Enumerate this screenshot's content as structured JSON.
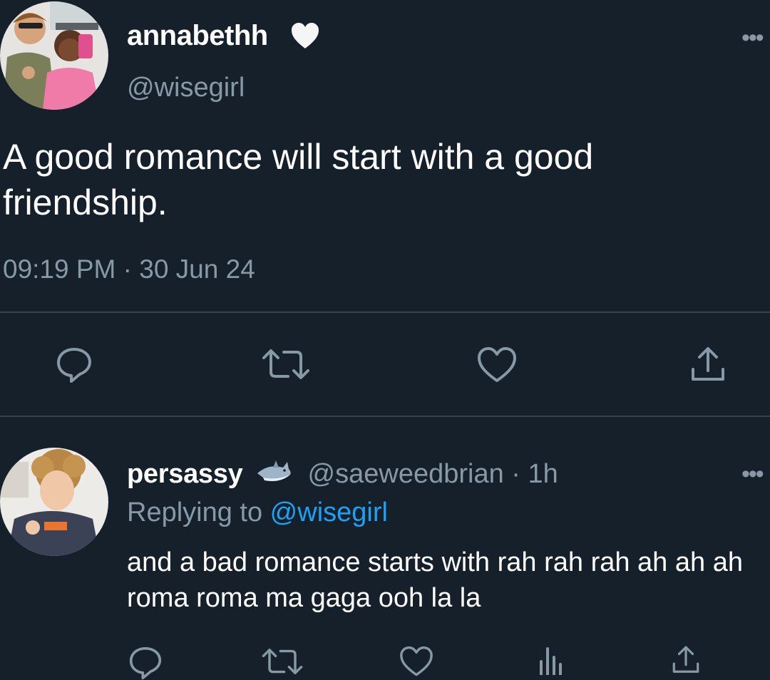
{
  "main_tweet": {
    "display_name": "annabethh",
    "name_badge": "white-heart-emoji",
    "handle": "@wisegirl",
    "text": "A good romance will start with a good friendship.",
    "timestamp": "09:19 PM · 30 Jun 24",
    "more_label": "•••",
    "actions": [
      "reply-icon",
      "retweet-icon",
      "like-icon",
      "share-icon"
    ]
  },
  "reply": {
    "display_name": "persassy",
    "name_badge": "shark-emoji",
    "handle": "@saeweedbrian",
    "separator": " · ",
    "time": "1h",
    "replying_prefix": "Replying to ",
    "replying_to": "@wisegirl",
    "text": "and a bad romance starts with rah rah rah ah ah ah roma roma ma gaga ooh la la",
    "more_label": "•••",
    "actions": [
      "reply-icon",
      "retweet-icon",
      "like-icon",
      "analytics-icon",
      "share-icon"
    ]
  },
  "colors": {
    "background": "#15202b",
    "primary_text": "#ffffff",
    "secondary_text": "#8899a6",
    "link": "#1da1f2",
    "divider": "#38444d"
  }
}
